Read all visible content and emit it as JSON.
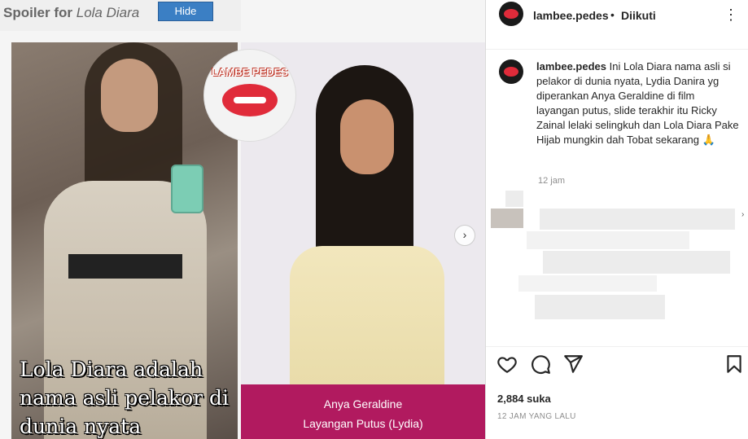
{
  "spoiler": {
    "label_bold": "Spoiler for",
    "label_italic": "Lola Diara",
    "hide_button": "Hide"
  },
  "media": {
    "logo_text": "LAMBE PEDES",
    "caption_left": "Lola Diara adalah nama asli pelakor di dunia nyata",
    "name_box_line1": "Anya Geraldine",
    "name_box_line2": "Layangan Putus (Lydia)",
    "next_icon": "chevron-right-icon"
  },
  "header": {
    "username": "lambee.pedes",
    "dot": "•",
    "follow_status": "Diikuti",
    "more_icon": "more-dots-icon"
  },
  "post": {
    "username": "lambee.pedes",
    "text": "Ini Lola Diara nama asli si pelakor di dunia nyata, Lydia Danira yg diperankan Anya Geraldine di film layangan putus, slide terakhir itu Ricky Zainal lelaki selingkuh dan Lola Diara Pake Hijab mungkin dah Tobat sekarang 🙏",
    "time": "12 jam"
  },
  "actions": {
    "like_icon": "heart-icon",
    "comment_icon": "comment-icon",
    "share_icon": "share-icon",
    "save_icon": "bookmark-icon"
  },
  "stats": {
    "likes": "2,884 suka",
    "posted_ago": "12 JAM YANG LALU"
  }
}
